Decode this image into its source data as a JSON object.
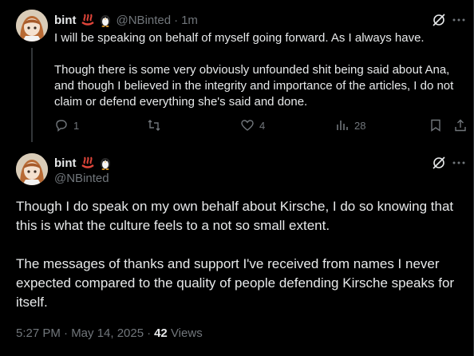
{
  "tweet1": {
    "name": "bint",
    "emojis": [
      "hot-springs-emoji",
      "penguin-emoji"
    ],
    "handle": "@NBinted",
    "time": "1m",
    "text": "I will be speaking on behalf of myself going forward. As I always have.\n\nThough there is some very obviously unfounded shit being said about Ana, and though I believed in the integrity and importance of the articles, I do not claim or defend everything she's said and done.",
    "replies": "1",
    "retweets": "",
    "likes": "4",
    "views": "28"
  },
  "tweet2": {
    "name": "bint",
    "emojis": [
      "hot-springs-emoji",
      "penguin-emoji"
    ],
    "handle": "@NBinted",
    "text": "Though I do speak on my own behalf about Kirsche, I do so knowing that this is what the culture feels to a not so small extent.\n\nThe messages of thanks and support I've received from names I never expected compared to the quality of people defending Kirsche speaks for itself.",
    "timestamp": "5:27 PM · May 14, 2025",
    "views_count": "42",
    "views_label": "Views"
  },
  "colors": {
    "background": "#000000",
    "text": "#e7e9ea",
    "muted": "#71767b",
    "divider": "#2f3336"
  }
}
